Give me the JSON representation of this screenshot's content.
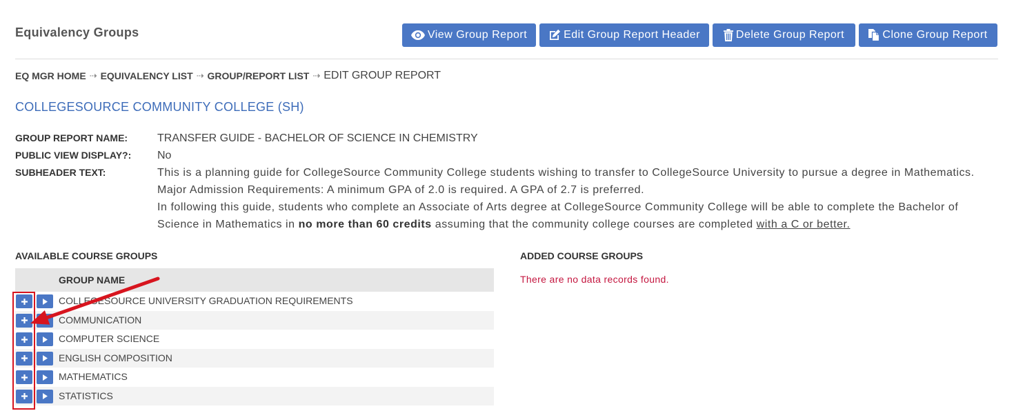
{
  "page": {
    "title": "Equivalency Groups"
  },
  "actions": [
    {
      "label": "View Group Report",
      "icon": "eye-icon"
    },
    {
      "label": "Edit Group Report Header",
      "icon": "edit-icon"
    },
    {
      "label": "Delete Group Report",
      "icon": "trash-icon"
    },
    {
      "label": "Clone Group Report",
      "icon": "copy-icon"
    }
  ],
  "breadcrumb": {
    "links": [
      "EQ MGR HOME",
      "EQUIVALENCY LIST",
      "GROUP/REPORT LIST"
    ],
    "current": "EDIT GROUP REPORT",
    "separator": "⇢"
  },
  "institution": "COLLEGESOURCE COMMUNITY COLLEGE (SH)",
  "details": {
    "group_report_name": {
      "label": "GROUP REPORT NAME:",
      "value": "TRANSFER GUIDE - BACHELOR OF SCIENCE IN CHEMISTRY"
    },
    "public_view_display": {
      "label": "PUBLIC VIEW DISPLAY?:",
      "value": "No"
    },
    "subheader": {
      "label": "SUBHEADER TEXT:",
      "paragraph_1": "This is a planning guide for CollegeSource Community College students wishing to transfer to CollegeSource University to pursue a degree in Mathematics.",
      "paragraph_2": "Major Admission Requirements: A minimum GPA of 2.0 is required. A GPA of 2.7 is preferred.",
      "paragraph_3": {
        "line_1": "In following this guide, students who complete an Associate of Arts degree at CollegeSource Community College will be able to complete the Bachelor of",
        "line_2_start": "Science in Mathematics in",
        "bold": "no more than 60 credits",
        "middle": "assuming that the community college courses are completed",
        "underlined": "with a C or better."
      }
    }
  },
  "available": {
    "heading": "AVAILABLE COURSE GROUPS",
    "column_header": "GROUP NAME",
    "row_icons": {
      "add": "plus-icon",
      "expand": "play-icon"
    },
    "rows": [
      "COLLEGESOURCE UNIVERSITY GRADUATION REQUIREMENTS",
      "COMMUNICATION",
      "COMPUTER SCIENCE",
      "ENGLISH COMPOSITION",
      "MATHEMATICS",
      "STATISTICS"
    ]
  },
  "added": {
    "heading": "ADDED COURSE GROUPS",
    "empty_message": "There are no data records found."
  },
  "colors": {
    "accent": "#4a77c5",
    "institution": "#3d6cb9",
    "empty_message": "#c4163f",
    "annotation": "#d7141e"
  }
}
